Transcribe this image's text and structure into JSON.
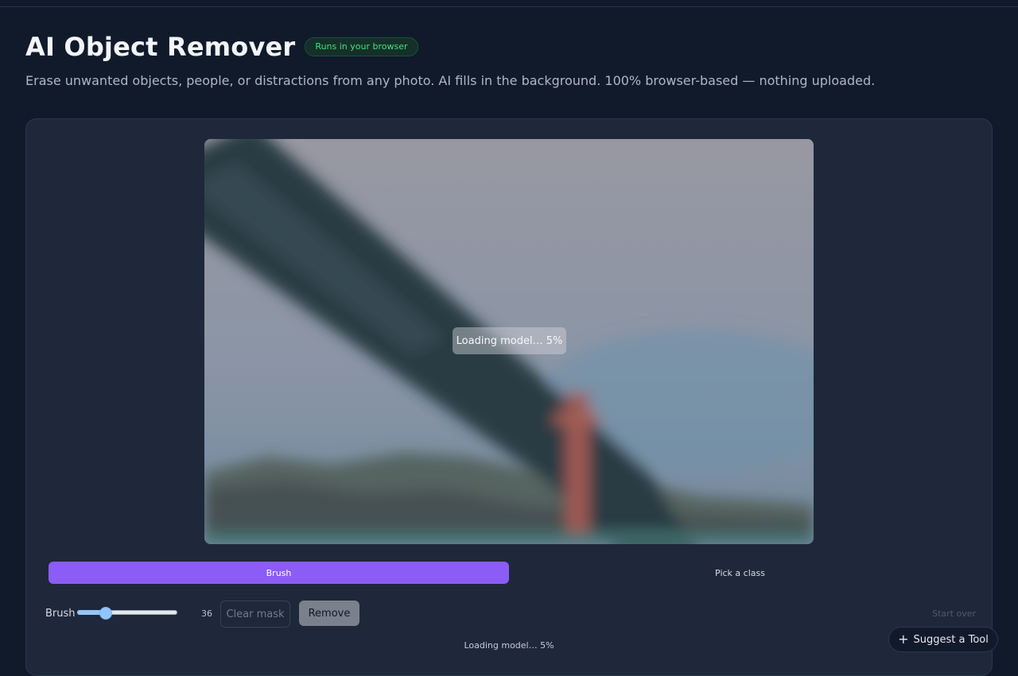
{
  "header": {
    "title": "AI Object Remover",
    "badge": "Runs in your browser",
    "subtitle": "Erase unwanted objects, people, or distractions from any photo. AI fills in the background. 100% browser-based — nothing uploaded."
  },
  "canvas": {
    "overlay_text": "Loading model… 5%"
  },
  "modes": {
    "brush_label": "Brush",
    "pick_label": "Pick a class"
  },
  "controls": {
    "brush_label": "Brush",
    "brush_value": "36",
    "clear_mask_label": "Clear mask",
    "remove_label": "Remove",
    "start_over_label": "Start over",
    "brush_size_fraction": 0.28
  },
  "status": {
    "text": "Loading model… 5%"
  },
  "suggest": {
    "icon": "plus-icon",
    "label": "Suggest a Tool"
  },
  "colors": {
    "background": "#111a2b",
    "panel": "#1e283a",
    "accent": "#8b5cf6",
    "badge_text": "#4ade80"
  }
}
